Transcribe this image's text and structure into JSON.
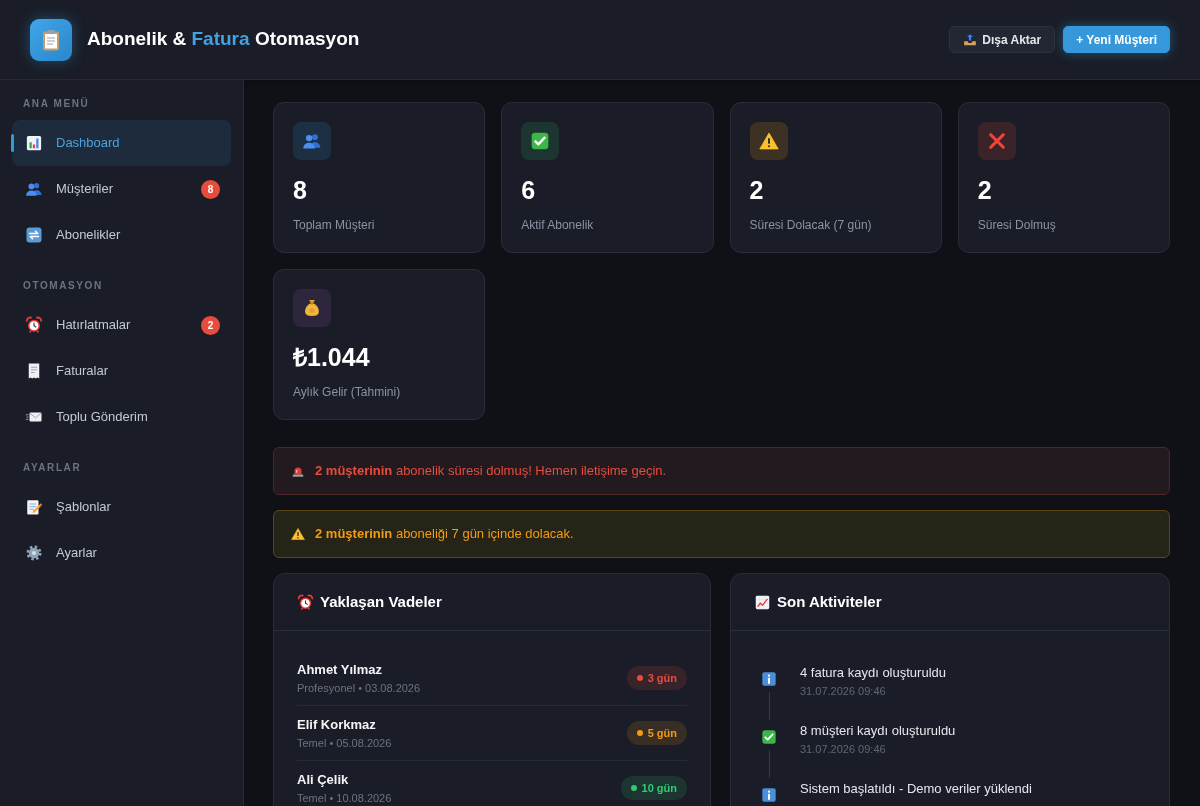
{
  "header": {
    "title_parts": [
      {
        "text": "Abonelik &",
        "highlight": false
      },
      {
        "text": "Fatura",
        "highlight": true
      },
      {
        "text": "Otomasyon",
        "highlight": false
      }
    ],
    "buttons": [
      {
        "label": "Dışa Aktar",
        "kind": "secondary"
      },
      {
        "label": "+ Yeni Müşteri",
        "kind": "primary"
      }
    ]
  },
  "sidebar": {
    "sections": [
      {
        "label": "ANA MENÜ",
        "items": [
          {
            "label": "Dashboard",
            "selected": true
          },
          {
            "label": "Müşteriler",
            "selected": false,
            "badge": "8"
          },
          {
            "label": "Abonelikler",
            "selected": false
          }
        ]
      },
      {
        "label": "OTOMASYON",
        "items": [
          {
            "label": "Hatırlatmalar",
            "selected": false,
            "badge": "2"
          },
          {
            "label": "Faturalar",
            "selected": false
          },
          {
            "label": "Toplu Gönderim",
            "selected": false
          }
        ]
      },
      {
        "label": "AYARLAR",
        "items": [
          {
            "label": "Şablonlar",
            "selected": false
          },
          {
            "label": "Ayarlar",
            "selected": false
          }
        ]
      }
    ]
  },
  "stats": [
    {
      "value": "8",
      "label": "Toplam Müşteri"
    },
    {
      "value": "6",
      "label": "Aktif Abonelik"
    },
    {
      "value": "2",
      "label": "Süresi Dolacak (7 gün)"
    },
    {
      "value": "2",
      "label": "Süresi Dolmuş"
    },
    {
      "value": "₺1.044",
      "label": "Aylık Gelir (Tahmini)"
    }
  ],
  "alerts": [
    {
      "kind": "danger",
      "text": "**2 müşterinin** abonelik süresi dolmuş! Hemen iletişime geçin."
    },
    {
      "kind": "warning",
      "text": "**2 müşterinin** aboneliği 7 gün içinde dolacak."
    }
  ],
  "upcoming": {
    "title": "Yaklaşan Vadeler",
    "items": [
      {
        "name": "Ahmet Yılmaz",
        "detail": "Profesyonel • 03.08.2026",
        "days": "3 gün",
        "color": "#e74c3c"
      },
      {
        "name": "Elif Korkmaz",
        "detail": "Temel • 05.08.2026",
        "days": "5 gün",
        "color": "#f39c12"
      },
      {
        "name": "Ali Çelik",
        "detail": "Temel • 10.08.2026",
        "days": "10 gün",
        "color": "#2ecc71"
      }
    ]
  },
  "activities": {
    "title": "Son Aktiviteler",
    "items": [
      {
        "kind": "info",
        "text": "4 fatura kaydı oluşturuldu",
        "time": "31.07.2026 09:46"
      },
      {
        "kind": "success",
        "text": "8 müşteri kaydı oluşturuldu",
        "time": "31.07.2026 09:46"
      },
      {
        "kind": "info",
        "text": "Sistem başlatıldı - Demo veriler yüklendi"
      }
    ]
  }
}
